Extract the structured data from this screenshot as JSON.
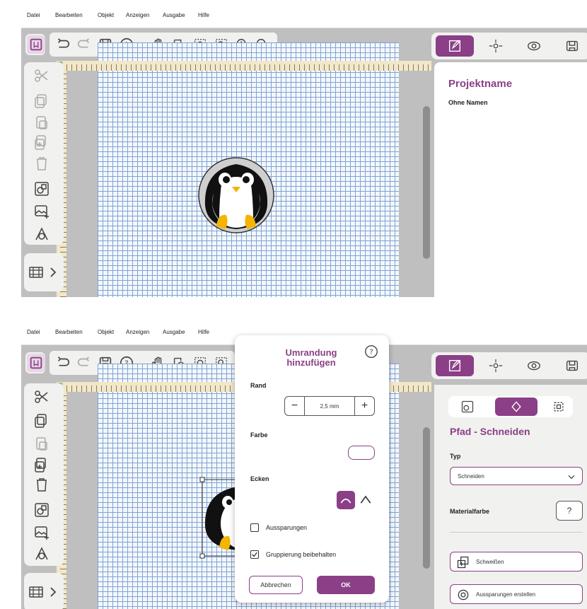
{
  "menu": [
    "Datei",
    "Bearbeiten",
    "Objekt",
    "Anzeigen",
    "Ausgabe",
    "Hilfe"
  ],
  "top_panel": {
    "title": "Projektname",
    "subtitle": "Ohne Namen"
  },
  "ruler_unit": "cm",
  "dialog": {
    "title_line1": "Umrandung",
    "title_line2": "hinzufügen",
    "rand_label": "Rand",
    "rand_value": "2,5 mm",
    "farbe_label": "Farbe",
    "ecken_label": "Ecken",
    "aussparungen_label": "Aussparungen",
    "aussparungen_checked": false,
    "gruppierung_label": "Gruppierung beibehalten",
    "gruppierung_checked": true,
    "cancel_label": "Abbrechen",
    "ok_label": "OK"
  },
  "bottom_panel": {
    "title": "Pfad - Schneiden",
    "typ_label": "Typ",
    "typ_value": "Schneiden",
    "materialfarbe_label": "Materialfarbe",
    "materialfarbe_button": "?",
    "weld_button": "Schweißen",
    "cutout_button": "Aussparungen erstellen"
  },
  "accent_color": "#8b3f86"
}
